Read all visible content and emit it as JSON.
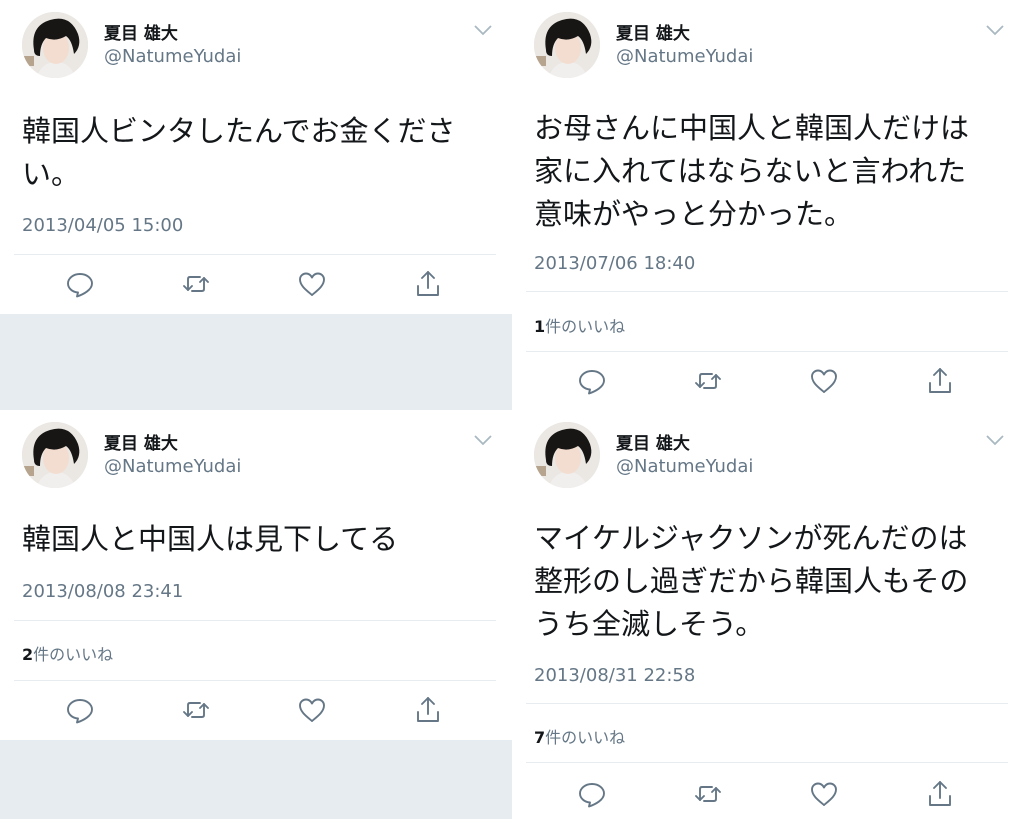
{
  "tweets": [
    {
      "name": "夏目 雄大",
      "handle": "@NatumeYudai",
      "text": "韓国人ビンタしたんでお金くださ\nい。",
      "timestamp": "2013/04/05 15:00",
      "likes_count": "",
      "likes_label": ""
    },
    {
      "name": "夏目 雄大",
      "handle": "@NatumeYudai",
      "text": "お母さんに中国人と韓国人だけは\n家に入れてはならないと言われた\n意味がやっと分かった。",
      "timestamp": "2013/07/06 18:40",
      "likes_count": "1",
      "likes_label": "件のいいね"
    },
    {
      "name": "夏目 雄大",
      "handle": "@NatumeYudai",
      "text": "韓国人と中国人は見下してる",
      "timestamp": "2013/08/08 23:41",
      "likes_count": "2",
      "likes_label": "件のいいね"
    },
    {
      "name": "夏目 雄大",
      "handle": "@NatumeYudai",
      "text": "マイケルジャクソンが死んだのは\n整形のし過ぎだから韓国人もその\nうち全滅しそう。",
      "timestamp": "2013/08/31 22:58",
      "likes_count": "7",
      "likes_label": "件のいいね"
    }
  ],
  "icons": {
    "reply": "reply-icon",
    "retweet": "retweet-icon",
    "like": "heart-icon",
    "share": "share-icon",
    "menu": "chevron-down-icon"
  },
  "colors": {
    "text": "#14171a",
    "secondary": "#657786",
    "divider": "#e6ecf0",
    "gray_fill": "#e6ecf0"
  }
}
